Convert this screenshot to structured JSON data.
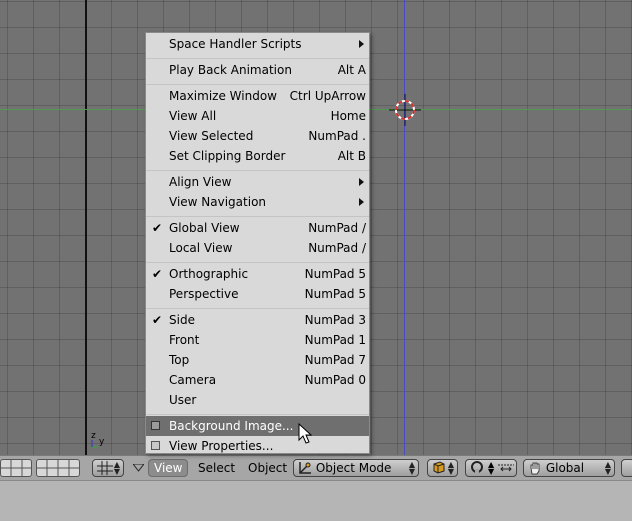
{
  "view_menu": {
    "items": [
      {
        "label": "Space Handler Scripts",
        "shortcut": "",
        "submenu": true
      },
      {
        "label": "Play Back Animation",
        "shortcut": "Alt A"
      },
      {
        "label": "Maximize Window",
        "shortcut": "Ctrl UpArrow"
      },
      {
        "label": "View All",
        "shortcut": "Home"
      },
      {
        "label": "View Selected",
        "shortcut": "NumPad ."
      },
      {
        "label": "Set Clipping Border",
        "shortcut": "Alt B"
      },
      {
        "label": "Align View",
        "shortcut": "",
        "submenu": true
      },
      {
        "label": "View Navigation",
        "shortcut": "",
        "submenu": true
      },
      {
        "label": "Global View",
        "shortcut": "NumPad /",
        "checked": true
      },
      {
        "label": "Local View",
        "shortcut": "NumPad /"
      },
      {
        "label": "Orthographic",
        "shortcut": "NumPad 5",
        "checked": true
      },
      {
        "label": "Perspective",
        "shortcut": "NumPad 5"
      },
      {
        "label": "Side",
        "shortcut": "NumPad 3",
        "checked": true
      },
      {
        "label": "Front",
        "shortcut": "NumPad 1"
      },
      {
        "label": "Top",
        "shortcut": "NumPad 7"
      },
      {
        "label": "Camera",
        "shortcut": "NumPad 0"
      },
      {
        "label": "User",
        "shortcut": ""
      },
      {
        "label": "Background Image...",
        "shortcut": "",
        "toggle": true,
        "highlighted": true
      },
      {
        "label": "View Properties...",
        "shortcut": "",
        "toggle": true
      }
    ]
  },
  "header": {
    "menu_view": "View",
    "menu_select": "Select",
    "menu_object": "Object",
    "mode": "Object Mode",
    "orientation": "Global"
  },
  "mini_axis": {
    "z": "z",
    "y": "y"
  },
  "colors": {
    "viewport_bg": "#727272",
    "grid_line": "#5f5f5f",
    "axis_green": "#4f9a4f",
    "axis_blue": "#4a4ac8",
    "menu_bg": "#d9d9d9",
    "menu_highlight": "#6f6f6f",
    "cursor_red": "#d03030"
  }
}
